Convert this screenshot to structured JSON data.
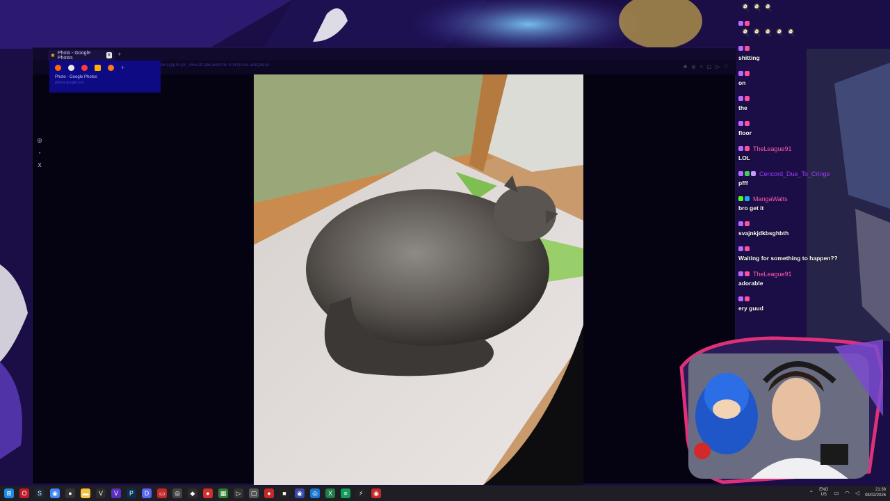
{
  "browser": {
    "tab_title": "Photo - Google Photos",
    "tab_close": "✕",
    "new_tab": "+",
    "url": "AF1QipN7y9_XR5OtCqwLB93YbT3-WQ0cw-JkdQ8dsn",
    "bookmark_title": "Photo - Google Photos",
    "bookmark_url": "photos.google.com",
    "nav_icons": [
      "zoom-icon",
      "shield-icon",
      "pin-icon",
      "square-icon",
      "play-icon",
      "heart-icon"
    ]
  },
  "sidebar": {
    "items": [
      "◎",
      "▪",
      "X"
    ]
  },
  "chat": {
    "messages": [
      {
        "user": "",
        "user_color": "#1f3cff",
        "text": ""
      },
      {
        "user": "",
        "user_color": "#1f3cff",
        "text": "shitting"
      },
      {
        "user": "",
        "user_color": "#1f3cff",
        "text": "on"
      },
      {
        "user": "",
        "user_color": "#1f3cff",
        "text": "the"
      },
      {
        "user": "",
        "user_color": "#1f3cff",
        "text": "floor"
      },
      {
        "user": "TheLeague91",
        "user_color": "#ff5aa8",
        "text": "LOL"
      },
      {
        "user": "Cencord_Due_To_Cringe",
        "user_color": "#a03cff",
        "text": "pfff"
      },
      {
        "user": "MangaWalts",
        "user_color": "#ff5aa8",
        "text": "bro get it"
      },
      {
        "user": "",
        "user_color": "#1f3cff",
        "text": "svajnkjdkbsghbth"
      },
      {
        "user": "",
        "user_color": "#ff1e1e",
        "text": "Waiting for something to happen??"
      },
      {
        "user": "TheLeague91",
        "user_color": "#ff5aa8",
        "text": "adorable"
      },
      {
        "user": "",
        "user_color": "#1f3cff",
        "text": "ery guud"
      }
    ]
  },
  "taskbar": {
    "language_top": "ENG",
    "language_bottom": "US",
    "time": "21:38",
    "date": "08/02/2026"
  },
  "colors": {
    "accent": "#2a1463",
    "chat_text": "#ffffff",
    "taskbar": "#1f1e24"
  }
}
